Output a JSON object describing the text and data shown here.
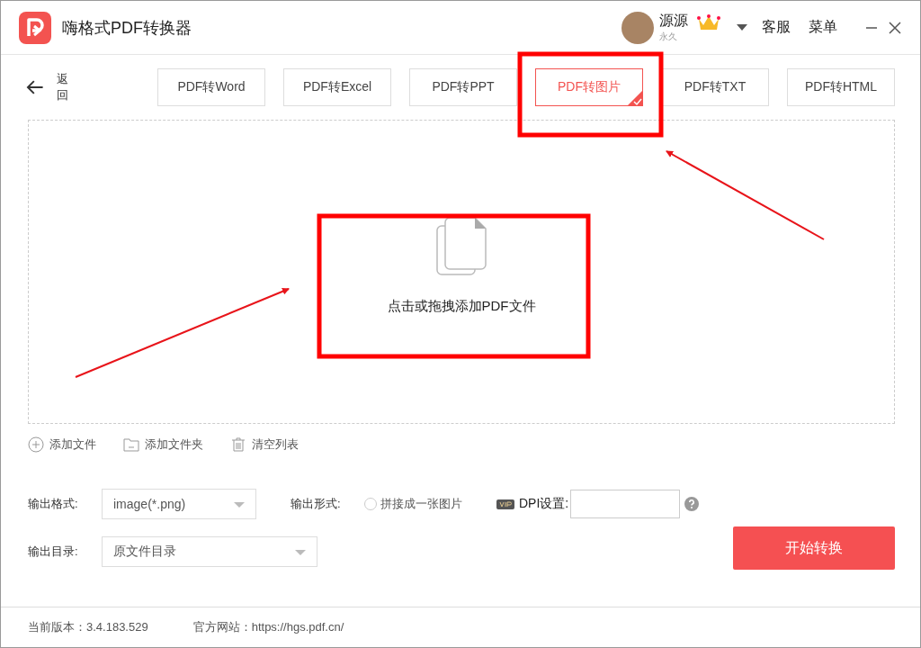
{
  "window": {
    "title": "嗨格式PDF转换器"
  },
  "user": {
    "name": "源源",
    "level": "永久"
  },
  "header_links": [
    "客服",
    "菜单"
  ],
  "back": "返回",
  "tabs": [
    {
      "label": "PDF转Word",
      "selected": false
    },
    {
      "label": "PDF转Excel",
      "selected": false
    },
    {
      "label": "PDF转PPT",
      "selected": false
    },
    {
      "label": "PDF转图片",
      "selected": true
    },
    {
      "label": "PDF转TXT",
      "selected": false
    },
    {
      "label": "PDF转HTML",
      "selected": false
    }
  ],
  "drop_zone": {
    "text": "点击或拖拽添加PDF文件"
  },
  "actions": [
    {
      "kind": "add",
      "label": "添加文件"
    },
    {
      "kind": "folder",
      "label": "添加文件夹"
    },
    {
      "kind": "clear",
      "label": "清空列表"
    }
  ],
  "output_format": {
    "label": "输出格式:",
    "value": "image(*.png)"
  },
  "output_mode": {
    "label": "输出形式:",
    "option": "拼接成一张图片",
    "checked": false
  },
  "dpi": {
    "label": "DPI设置:"
  },
  "output_dir": {
    "label": "输出目录:",
    "value": "原文件目录"
  },
  "start_button": "开始转换",
  "footer": {
    "version": "当前版本：3.4.183.529",
    "website": "官方网站：https://hgs.pdf.cn/"
  }
}
